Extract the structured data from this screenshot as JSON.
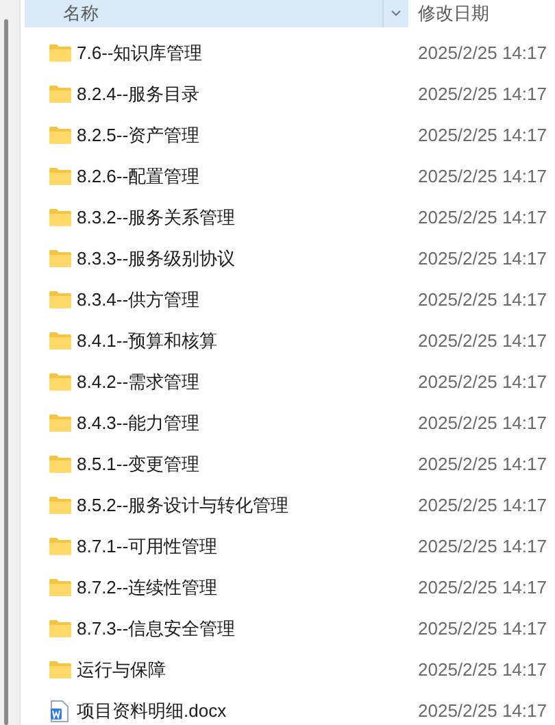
{
  "columns": [
    {
      "label": "名称",
      "sorted": true
    },
    {
      "label": "修改日期"
    }
  ],
  "files": [
    {
      "kind": "folder",
      "name": "7.6--知识库管理",
      "modified": "2025/2/25 14:17"
    },
    {
      "kind": "folder",
      "name": "8.2.4--服务目录",
      "modified": "2025/2/25 14:17"
    },
    {
      "kind": "folder",
      "name": "8.2.5--资产管理",
      "modified": "2025/2/25 14:17"
    },
    {
      "kind": "folder",
      "name": "8.2.6--配置管理",
      "modified": "2025/2/25 14:17"
    },
    {
      "kind": "folder",
      "name": "8.3.2--服务关系管理",
      "modified": "2025/2/25 14:17"
    },
    {
      "kind": "folder",
      "name": "8.3.3--服务级别协议",
      "modified": "2025/2/25 14:17"
    },
    {
      "kind": "folder",
      "name": "8.3.4--供方管理",
      "modified": "2025/2/25 14:17"
    },
    {
      "kind": "folder",
      "name": "8.4.1--预算和核算",
      "modified": "2025/2/25 14:17"
    },
    {
      "kind": "folder",
      "name": "8.4.2--需求管理",
      "modified": "2025/2/25 14:17"
    },
    {
      "kind": "folder",
      "name": "8.4.3--能力管理",
      "modified": "2025/2/25 14:17"
    },
    {
      "kind": "folder",
      "name": "8.5.1--变更管理",
      "modified": "2025/2/25 14:17"
    },
    {
      "kind": "folder",
      "name": "8.5.2--服务设计与转化管理",
      "modified": "2025/2/25 14:17"
    },
    {
      "kind": "folder",
      "name": "8.7.1--可用性管理",
      "modified": "2025/2/25 14:17"
    },
    {
      "kind": "folder",
      "name": "8.7.2--连续性管理",
      "modified": "2025/2/25 14:17"
    },
    {
      "kind": "folder",
      "name": "8.7.3--信息安全管理",
      "modified": "2025/2/25 14:17"
    },
    {
      "kind": "folder",
      "name": "运行与保障",
      "modified": "2025/2/25 14:17"
    },
    {
      "kind": "docx",
      "name": "项目资料明细.docx",
      "modified": "2025/2/25 14:17"
    }
  ]
}
